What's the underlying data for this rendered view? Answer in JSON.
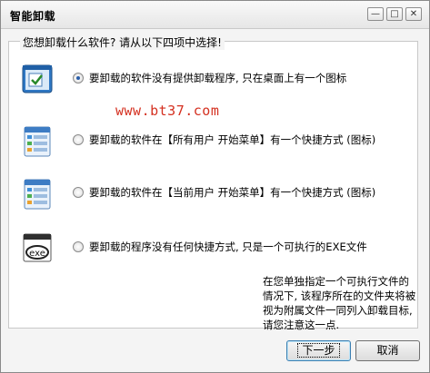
{
  "window": {
    "title": "智能卸载",
    "minimize": "—",
    "maximize": "□",
    "close": "✕"
  },
  "group": {
    "title": "您想卸载什么软件? 请从以下四项中选择!"
  },
  "options": [
    {
      "label": "要卸载的软件没有提供卸载程序, 只在桌面上有一个图标",
      "checked": true,
      "icon": "app-window-icon"
    },
    {
      "label": "要卸载的软件在【所有用户 开始菜单】有一个快捷方式 (图标)",
      "checked": false,
      "icon": "start-menu-all-users-icon"
    },
    {
      "label": "要卸载的软件在【当前用户 开始菜单】有一个快捷方式 (图标)",
      "checked": false,
      "icon": "start-menu-current-user-icon"
    },
    {
      "label": "要卸载的程序没有任何快捷方式, 只是一个可执行的EXE文件",
      "checked": false,
      "icon": "exe-file-icon"
    }
  ],
  "watermark": "www.bt37.com",
  "note": "在您单独指定一个可执行文件的情况下, 该程序所在的文件夹将被视为附属文件一同列入卸载目标, 请您注意这一点.",
  "buttons": {
    "next": "下一步",
    "cancel": "取消"
  },
  "exe_icon_text": "exe"
}
